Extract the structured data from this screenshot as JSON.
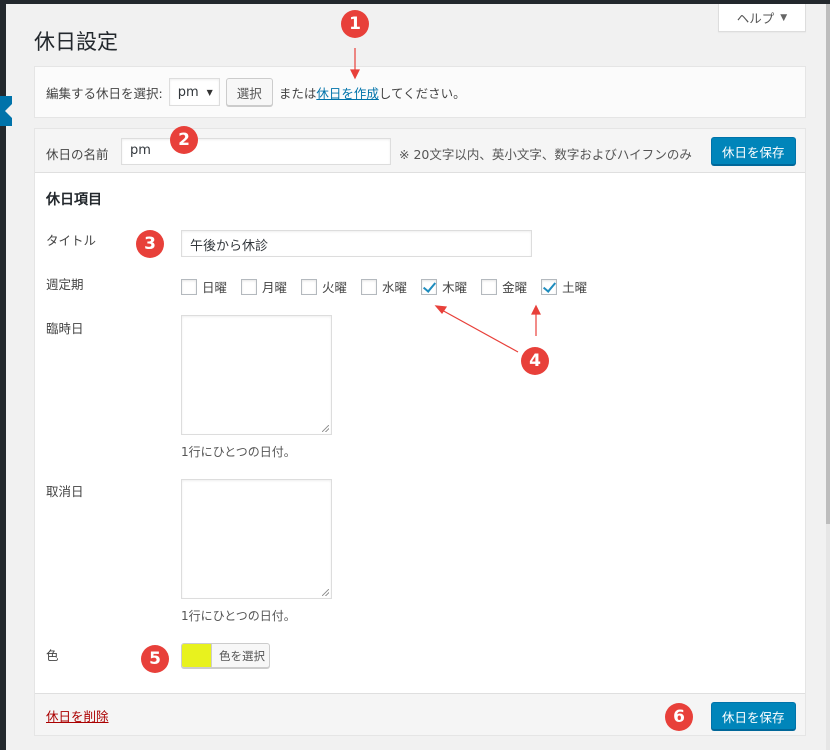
{
  "help": {
    "label": "ヘルプ",
    "caret": "▼"
  },
  "page": {
    "title": "休日設定"
  },
  "selector": {
    "label": "編集する休日を選択:",
    "selected": "pm",
    "button": "選択",
    "or_text": "または",
    "create_link": "休日を作成",
    "suffix": "してください。"
  },
  "form": {
    "name_label": "休日の名前",
    "name_value": "pm",
    "name_hint": "※ 20文字以内、英小文字、数字およびハイフンのみ",
    "save_label": "休日を保存",
    "section_title": "休日項目",
    "title_label": "タイトル",
    "title_value": "午後から休診",
    "weekly_label": "週定期",
    "weekdays": [
      {
        "label": "日曜",
        "checked": false
      },
      {
        "label": "月曜",
        "checked": false
      },
      {
        "label": "火曜",
        "checked": false
      },
      {
        "label": "水曜",
        "checked": false
      },
      {
        "label": "木曜",
        "checked": true
      },
      {
        "label": "金曜",
        "checked": false
      },
      {
        "label": "土曜",
        "checked": true
      }
    ],
    "temp_label": "臨時日",
    "temp_hint": "1行にひとつの日付。",
    "cancel_label": "取消日",
    "cancel_hint": "1行にひとつの日付。",
    "color_label": "色",
    "color_button": "色を選択",
    "color_value": "#e8f21e",
    "delete_link": "休日を削除"
  },
  "annotations": {
    "b1": "1",
    "b2": "2",
    "b3": "3",
    "b4": "4",
    "b5": "5",
    "b6": "6",
    "color": "#e8403a"
  },
  "colors": {
    "primary": "#0085ba",
    "link": "#0073aa",
    "danger": "#aa0000"
  }
}
